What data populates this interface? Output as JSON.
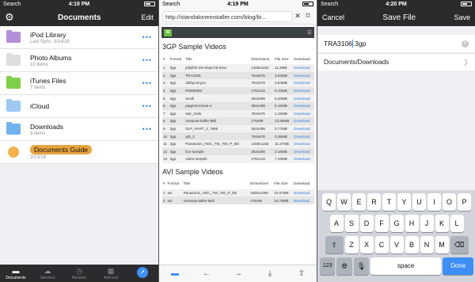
{
  "status_bars": [
    {
      "carrier": "Search",
      "time": "4:19 PM",
      "battery_pct": ""
    },
    {
      "carrier": "Search",
      "time": "4:19 PM",
      "battery_pct": ""
    },
    {
      "carrier": "Search",
      "time": "4:20 PM",
      "battery_pct": ""
    }
  ],
  "documents_screen": {
    "title": "Documents",
    "edit_label": "Edit",
    "items": [
      {
        "name": "iPod Library",
        "sub": "Last Sync: 3/14/18",
        "icon": "music-folder-icon",
        "color": "#b48fd9"
      },
      {
        "name": "Photo Albums",
        "sub": "10 items",
        "icon": "photos-folder-icon",
        "color": "#dddddd"
      },
      {
        "name": "iTunes Files",
        "sub": "7 items",
        "icon": "itunes-folder-icon",
        "color": "#7dcf48"
      },
      {
        "name": "iCloud",
        "sub": "",
        "icon": "icloud-folder-icon",
        "color": "#9ccaf2"
      },
      {
        "name": "Downloads",
        "sub": "9 items",
        "icon": "downloads-folder-icon",
        "color": "#6fb3ee"
      },
      {
        "name": "Documents Guide",
        "sub": "2/13/18",
        "icon": "guide-icon",
        "color": "#f3b24b"
      }
    ],
    "more_label": "•••",
    "tabs": [
      {
        "label": "Documents",
        "icon": "folder-icon",
        "glyph": "▬",
        "active": true
      },
      {
        "label": "Services",
        "icon": "cloud-icon",
        "glyph": "☁",
        "active": false
      },
      {
        "label": "Recents",
        "icon": "clock-icon",
        "glyph": "◷",
        "active": false
      },
      {
        "label": "Add-ons",
        "icon": "addons-icon",
        "glyph": "▦",
        "active": false
      },
      {
        "label": "",
        "icon": "compass-icon",
        "glyph": "➚",
        "active": false
      }
    ]
  },
  "browser_screen": {
    "url": "http://standaloneinstaller.com/blog/bi...",
    "logo_text": "SI",
    "section1_title": "3GP Sample Videos",
    "columns": [
      "#",
      "Format",
      "Title",
      "Dimentions",
      "File Size",
      "Download"
    ],
    "rows": [
      [
        "1",
        "3gp",
        "jellyfish-25-mbps-hd-hevc",
        "1408x1152",
        "11.2MB",
        "Download"
      ],
      [
        "2",
        "3gp",
        "TRA3106",
        "704x576",
        "3.03MB",
        "Download"
      ],
      [
        "3",
        "3gp",
        "dolbycanyon",
        "704x576",
        "0.84MB",
        "Download"
      ],
      [
        "4",
        "3gp",
        "P6090053",
        "176x144",
        "0.43MB",
        "Download"
      ],
      [
        "5",
        "3gp",
        "small",
        "352x288",
        "0.33MB",
        "Download"
      ],
      [
        "6",
        "3gp",
        "page18-movie-4",
        "352x288",
        "6.16MB",
        "Download"
      ],
      [
        "7",
        "3gp",
        "star_trails",
        "704x576",
        "1.15MB",
        "Download"
      ],
      [
        "8",
        "3gp",
        "metaxas-keller-Bell",
        "176x99",
        "13.65MB",
        "Download"
      ],
      [
        "9",
        "3gp",
        "DLP_PART_2_768k",
        "352x288",
        "3.77MB",
        "Download"
      ],
      [
        "10",
        "3gp",
        "grb_2",
        "704x576",
        "0.35MB",
        "Download"
      ],
      [
        "11",
        "3gp",
        "Panasonic_HDC_TM_700_P_50i",
        "1408x1152",
        "11.27MB",
        "Download"
      ],
      [
        "12",
        "3gp",
        "lion-sample",
        "352x288",
        "3.16MB",
        "Download"
      ],
      [
        "13",
        "3gp",
        "video-sample",
        "176x144",
        "7.15MB",
        "Download"
      ]
    ],
    "section2_title": "AVI Sample Videos",
    "columns2": [
      "#",
      "Format",
      "Title",
      "Dimentions",
      "File Size",
      "Download"
    ],
    "rows2": [
      [
        "1",
        "avi",
        "Panasonic_HDC_TM_700_P_50i",
        "1920x1080",
        "10.67MB",
        "Download"
      ],
      [
        "2",
        "avi",
        "metaxas-keller-Bell",
        "176x99",
        "34.79MB",
        "Download"
      ]
    ],
    "toolbar": [
      {
        "icon": "folder-icon",
        "glyph": "▬"
      },
      {
        "icon": "back-arrow-icon",
        "glyph": "←"
      },
      {
        "icon": "forward-arrow-icon",
        "glyph": "→"
      },
      {
        "icon": "download-icon",
        "glyph": "⤓"
      },
      {
        "icon": "share-icon",
        "glyph": "⇪"
      }
    ]
  },
  "save_screen": {
    "cancel_label": "Cancel",
    "title": "Save File",
    "save_label": "Save",
    "filename_before_caret": "TRA3106",
    "filename_after_caret": ".3gp",
    "destination": "Documents/Downloads",
    "keyboard": {
      "row1": [
        "Q",
        "W",
        "E",
        "R",
        "T",
        "Y",
        "U",
        "I",
        "O",
        "P"
      ],
      "row2": [
        "A",
        "S",
        "D",
        "F",
        "G",
        "H",
        "J",
        "K",
        "L"
      ],
      "row3": [
        "Z",
        "X",
        "C",
        "V",
        "B",
        "N",
        "M"
      ],
      "num_label": "123",
      "space_label": "space",
      "done_label": "Done"
    }
  }
}
